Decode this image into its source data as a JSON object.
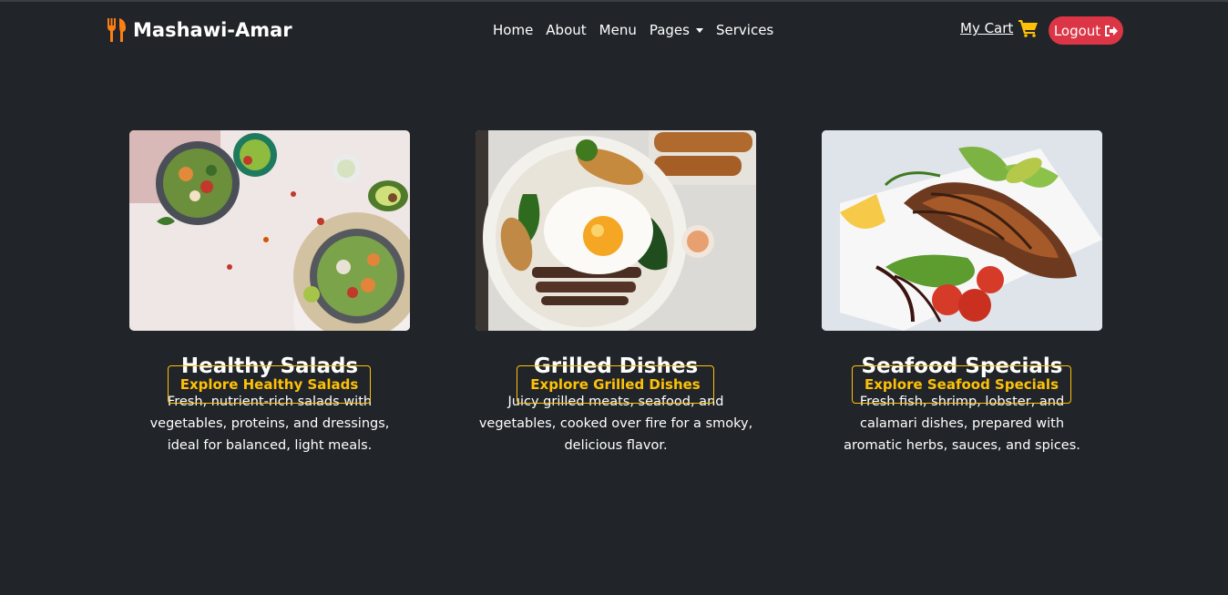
{
  "navbar": {
    "brand": "Mashawi-Amar",
    "links": [
      {
        "label": "Home"
      },
      {
        "label": "About"
      },
      {
        "label": "Menu"
      },
      {
        "label": "Pages"
      },
      {
        "label": "Services"
      }
    ],
    "cart_label": "My Cart",
    "logout_label": "Logout"
  },
  "cards": [
    {
      "title": "Healthy Salads",
      "description": "Fresh, nutrient-rich salads with vegetables, proteins, and dressings, ideal for balanced, light meals.",
      "button": "Explore Healthy Salads",
      "image_subject": "salad-bowls-photo"
    },
    {
      "title": "Grilled Dishes",
      "description": "Juicy grilled meats, seafood, and vegetables, cooked over fire for a smoky, delicious flavor.",
      "button": "Explore Grilled Dishes",
      "image_subject": "grilled-bowl-photo"
    },
    {
      "title": "Seafood Specials",
      "description": "Fresh fish, shrimp, lobster, and calamari dishes, prepared with aromatic herbs, sauces, and spices.",
      "button": "Explore Seafood Specials",
      "image_subject": "grilled-salmon-photo"
    }
  ],
  "colors": {
    "background": "#212529",
    "brand_accent": "#fd7e14",
    "cart_accent": "#ffc107",
    "logout": "#dc3545",
    "button_outline": "#ffc107"
  },
  "icons": {
    "brand": "utensils-icon",
    "cart": "shopping-cart-icon",
    "logout": "sign-out-icon",
    "dropdown": "caret-down-icon"
  }
}
